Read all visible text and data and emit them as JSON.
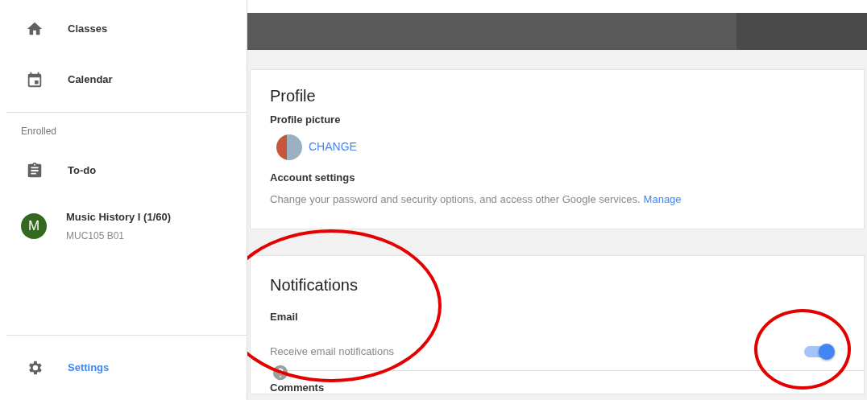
{
  "sidebar": {
    "items": [
      {
        "kind": "nav",
        "label": "Classes",
        "selected": false
      },
      {
        "kind": "nav",
        "label": "Calendar",
        "selected": false
      },
      {
        "kind": "divider"
      },
      {
        "kind": "heading",
        "label": "Enrolled"
      },
      {
        "kind": "nav",
        "label": "To-do",
        "selected": false
      },
      {
        "kind": "class",
        "initial": "M",
        "color": "#33691e",
        "label": "Music History I (1/60)",
        "subtitle": "MUC105 B01",
        "selected": false
      }
    ],
    "footer": {
      "label": "Settings",
      "selected": true
    }
  },
  "profile": {
    "title": "Profile",
    "picture_label": "Profile picture",
    "change_button": "CHANGE",
    "account_label": "Account settings",
    "account_text": "Change your password and security options, and access other Google services.",
    "account_link": "Manage"
  },
  "notifications": {
    "title": "Notifications",
    "highlighted": true,
    "section_label": "Email",
    "settings": [
      {
        "label": "Receive email notifications",
        "on": true,
        "highlighted": true
      }
    ],
    "next_label": "Comments"
  }
}
